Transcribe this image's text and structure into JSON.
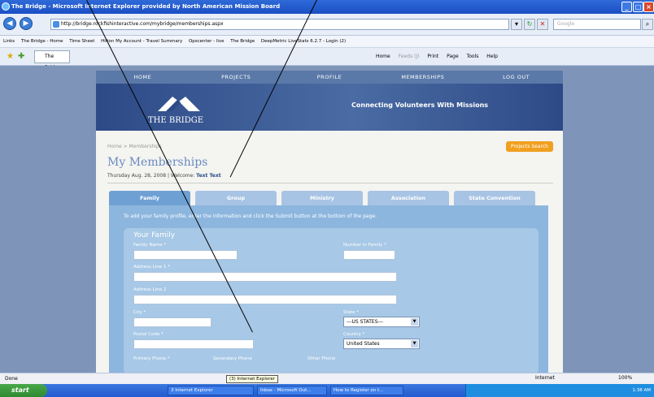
{
  "browser": {
    "title": "The Bridge - Microsoft Internet Explorer provided by North American Mission Board",
    "url": "http://bridge.rockfishinteractive.com/mybridge/memberships.aspx",
    "search_placeholder": "Google",
    "links_label": "Links",
    "links": [
      "The Bridge - Home",
      "Time Sheet",
      "Hilton My Account - Travel Summary",
      "Opscenter - live",
      "The Bridge",
      "DeepMetric LiveStats 6.2.7 - Login (2)"
    ],
    "tab": "The Bridge",
    "tools": [
      "Home",
      "Feeds (J)",
      "Print",
      "Page",
      "Tools",
      "Help"
    ]
  },
  "site": {
    "nav": [
      "HOME",
      "PROJECTS",
      "PROFILE",
      "MEMBERSHIPS",
      "LOG OUT"
    ],
    "logo": "THE BRIDGE",
    "tagline": "Connecting Volunteers With Missions",
    "breadcrumb": "Home > Memberships",
    "projects_search": "Projects Search",
    "page_title": "My Memberships",
    "date": "Thursday Aug. 28, 2008 | Welcome:",
    "user": "Text Text",
    "tabs": [
      "Family",
      "Group",
      "Ministry",
      "Association",
      "State Convention"
    ],
    "instructions": "To add your family profile, enter the information and click the Submit button at the bottom of the page.",
    "form": {
      "heading": "Your Family",
      "family_name": "Family Name *",
      "number_in_family": "Number in Family *",
      "address1": "Address Line 1 *",
      "address2": "Address Line 2",
      "city": "City *",
      "state": "State *",
      "state_value": "---US STATES---",
      "postal": "Postal Code *",
      "country": "Country *",
      "country_value": "United States",
      "primary_phone": "Primary Phone *",
      "secondary_phone": "Secondary Phone",
      "other_phone": "Other Phone"
    }
  },
  "status": {
    "left": "Done",
    "tooltip": "(3) Internet Explorer",
    "zone": "Internet",
    "zoom": "100%"
  },
  "taskbar": {
    "start": "start",
    "items": [
      "3 Internet Explorer",
      "Inbox - Microsoft Out...",
      "How to Register on t..."
    ],
    "clock": "1:38 AM"
  }
}
